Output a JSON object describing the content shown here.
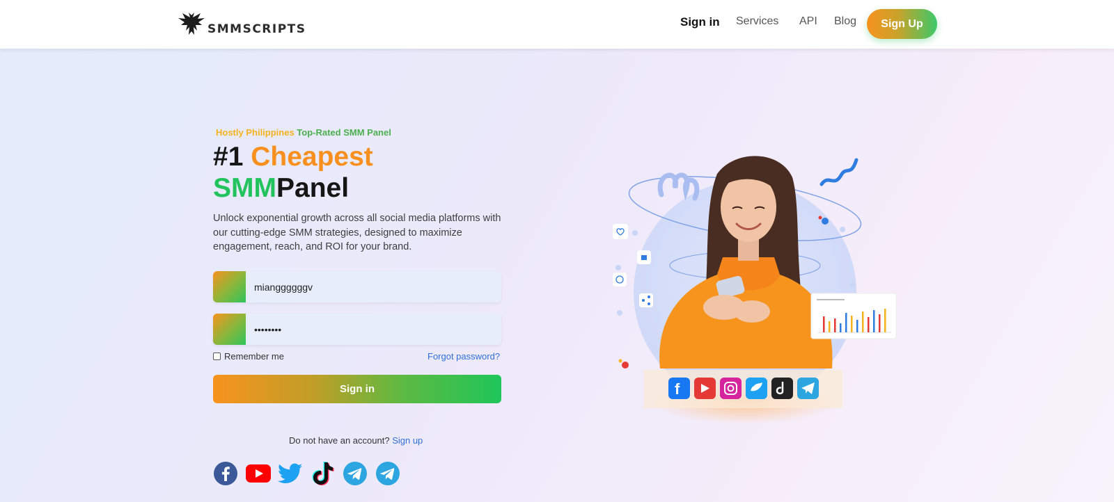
{
  "header": {
    "logo_text": "SMMSCRIPTS",
    "nav": {
      "signin": "Sign in",
      "services": "Services",
      "api": "API",
      "blog": "Blog"
    },
    "signup_label": "Sign Up"
  },
  "hero": {
    "tagline_brand": "Hostly Philippines",
    "tagline_rest": " Top-Rated SMM Panel",
    "headline_num": "#1",
    "headline_cheapest": "Cheapest",
    "headline_smm": "SMM",
    "headline_panel": "Panel",
    "description": "Unlock exponential growth across all social media platforms with our cutting-edge SMM strategies, designed to maximize engagement, reach, and ROI for your brand."
  },
  "form": {
    "username_value": "mianggggggv",
    "password_value": "••••••••",
    "remember_label": "Remember me",
    "forgot_label": "Forgot password?",
    "signin_label": "Sign in",
    "no_account_text": "Do not have an account?",
    "signup_link": "Sign up"
  },
  "socials": [
    "facebook-icon",
    "youtube-icon",
    "twitter-icon",
    "tiktok-icon",
    "telegram-icon",
    "telegram-icon"
  ],
  "colors": {
    "orange": "#f7931e",
    "green": "#22c35d",
    "link_blue": "#2f6fd6",
    "tagline_yellow": "#f5b21f"
  }
}
